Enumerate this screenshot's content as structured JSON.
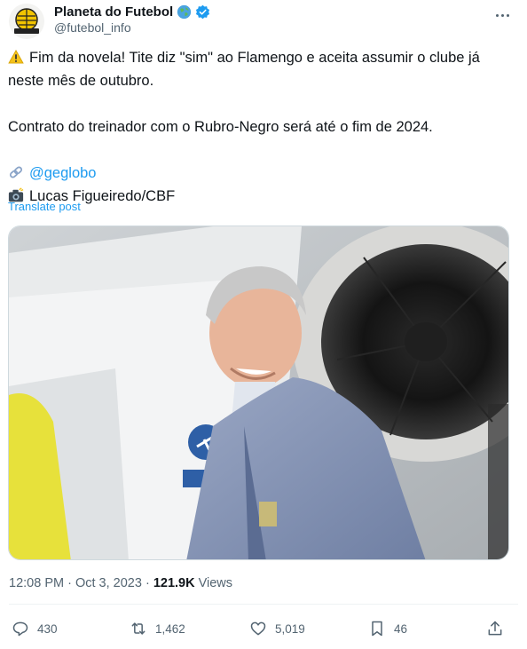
{
  "account": {
    "name": "Planeta do Futebol",
    "handle": "@futebol_info"
  },
  "post": {
    "line1": "Fim da novela! Tite diz \"sim\" ao Flamengo e aceita assumir o clube já",
    "line2": "neste mês de outubro.",
    "line3": "Contrato do treinador com o Rubro-Negro será até o fim de 2024.",
    "mention": "@geglobo",
    "photo_credit": "Lucas Figueiredo/CBF",
    "translate": "Translate post"
  },
  "meta": {
    "time_date": "12:08 PM · Oct 3, 2023 · ",
    "views_count": "121.9K",
    "views_label": " Views"
  },
  "actions": {
    "replies": "430",
    "reposts": "1,462",
    "likes": "5,019",
    "bookmarks": "46"
  },
  "colors": {
    "accent": "#1d9bf0",
    "text": "#0f1419",
    "muted": "#536471"
  },
  "icons": [
    "globe-icon",
    "verified-badge-icon",
    "more-icon",
    "warning-icon",
    "link-icon",
    "camera-icon",
    "reply-icon",
    "repost-icon",
    "like-icon",
    "bookmark-icon",
    "share-icon"
  ]
}
